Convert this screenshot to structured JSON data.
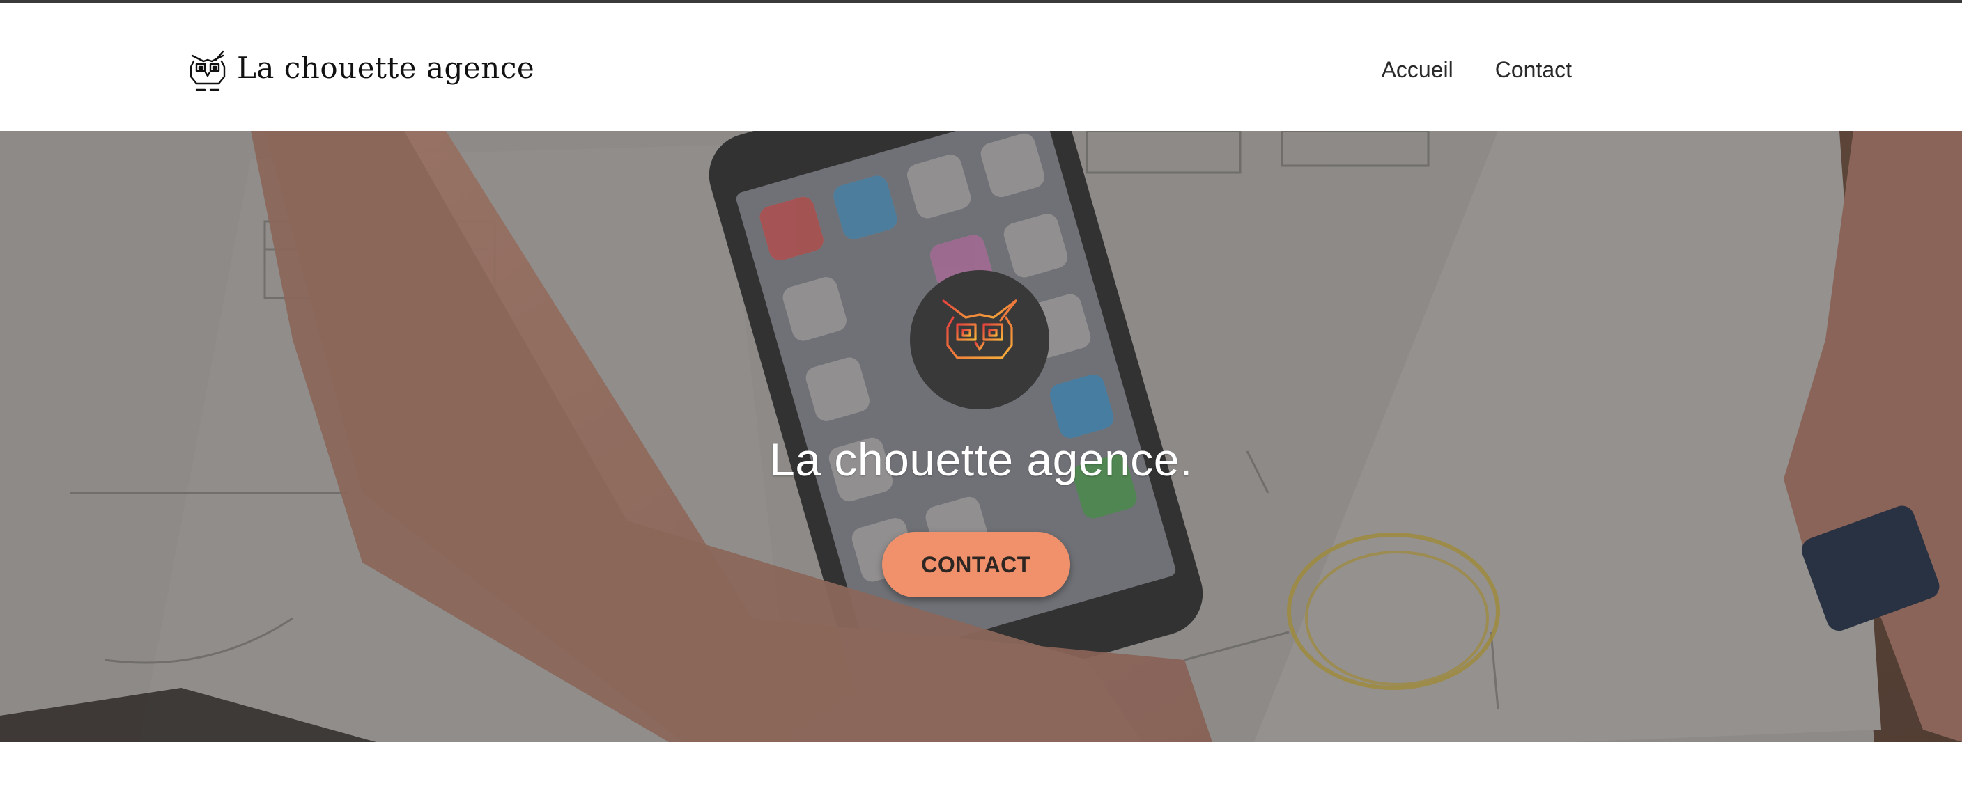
{
  "header": {
    "brand_name": "La chouette agence",
    "nav": [
      {
        "label": "Accueil"
      },
      {
        "label": "Contact"
      }
    ]
  },
  "hero": {
    "title": "La chouette agence.",
    "cta_label": "CONTACT"
  },
  "icons": {
    "brand_logo": "owl-icon",
    "hero_emblem": "owl-icon"
  },
  "colors": {
    "cta_background": "#f1916c",
    "cta_text": "#2d2622",
    "emblem_background": "#3a3939",
    "emblem_gradient_start": "#e5403e",
    "emblem_gradient_end": "#f6b43a",
    "top_rule": "#3a3a3a"
  }
}
